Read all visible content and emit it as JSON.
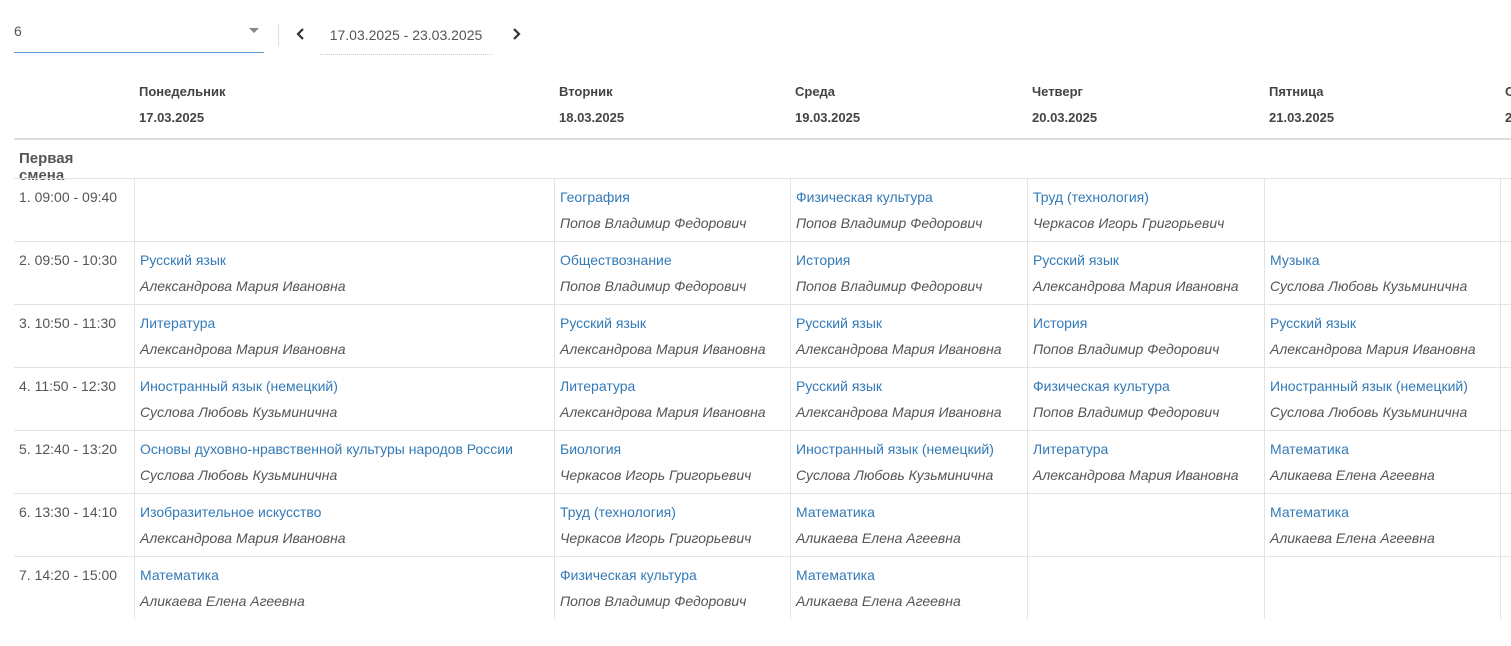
{
  "toolbar": {
    "class_value": "6",
    "week_range": "17.03.2025 - 23.03.2025"
  },
  "days": [
    {
      "name": "Понедельник",
      "date": "17.03.2025"
    },
    {
      "name": "Вторник",
      "date": "18.03.2025"
    },
    {
      "name": "Среда",
      "date": "19.03.2025"
    },
    {
      "name": "Четверг",
      "date": "20.03.2025"
    },
    {
      "name": "Пятница",
      "date": "21.03.2025"
    },
    {
      "name": "С",
      "date": "2"
    }
  ],
  "shift_title": "Первая смена",
  "periods": [
    {
      "time": "1. 09:00 - 09:40",
      "lessons": [
        null,
        {
          "subject": "География",
          "teacher": "Попов Владимир Федорович"
        },
        {
          "subject": "Физическая культура",
          "teacher": "Попов Владимир Федорович"
        },
        {
          "subject": "Труд (технология)",
          "teacher": "Черкасов Игорь Григорьевич"
        },
        null
      ]
    },
    {
      "time": "2. 09:50 - 10:30",
      "lessons": [
        {
          "subject": "Русский язык",
          "teacher": "Александрова Мария Ивановна"
        },
        {
          "subject": "Обществознание",
          "teacher": "Попов Владимир Федорович"
        },
        {
          "subject": "История",
          "teacher": "Попов Владимир Федорович"
        },
        {
          "subject": "Русский язык",
          "teacher": "Александрова Мария Ивановна"
        },
        {
          "subject": "Музыка",
          "teacher": "Суслова Любовь Кузьминична"
        }
      ]
    },
    {
      "time": "3. 10:50 - 11:30",
      "lessons": [
        {
          "subject": "Литература",
          "teacher": "Александрова Мария Ивановна"
        },
        {
          "subject": "Русский язык",
          "teacher": "Александрова Мария Ивановна"
        },
        {
          "subject": "Русский язык",
          "teacher": "Александрова Мария Ивановна"
        },
        {
          "subject": "История",
          "teacher": "Попов Владимир Федорович"
        },
        {
          "subject": "Русский язык",
          "teacher": "Александрова Мария Ивановна"
        }
      ]
    },
    {
      "time": "4. 11:50 - 12:30",
      "lessons": [
        {
          "subject": "Иностранный язык (немецкий)",
          "teacher": "Суслова Любовь Кузьминична"
        },
        {
          "subject": "Литература",
          "teacher": "Александрова Мария Ивановна"
        },
        {
          "subject": "Русский язык",
          "teacher": "Александрова Мария Ивановна"
        },
        {
          "subject": "Физическая культура",
          "teacher": "Попов Владимир Федорович"
        },
        {
          "subject": "Иностранный язык (немецкий)",
          "teacher": "Суслова Любовь Кузьминична"
        }
      ]
    },
    {
      "time": "5. 12:40 - 13:20",
      "lessons": [
        {
          "subject": "Основы духовно-нравственной культуры народов России",
          "teacher": "Суслова Любовь Кузьминична"
        },
        {
          "subject": "Биология",
          "teacher": "Черкасов Игорь Григорьевич"
        },
        {
          "subject": "Иностранный язык (немецкий)",
          "teacher": "Суслова Любовь Кузьминична"
        },
        {
          "subject": "Литература",
          "teacher": "Александрова Мария Ивановна"
        },
        {
          "subject": "Математика",
          "teacher": "Аликаева Елена Агеевна"
        }
      ]
    },
    {
      "time": "6. 13:30 - 14:10",
      "lessons": [
        {
          "subject": "Изобразительное искусство",
          "teacher": "Александрова Мария Ивановна"
        },
        {
          "subject": "Труд (технология)",
          "teacher": "Черкасов Игорь Григорьевич"
        },
        {
          "subject": "Математика",
          "teacher": "Аликаева Елена Агеевна"
        },
        null,
        {
          "subject": "Математика",
          "teacher": "Аликаева Елена Агеевна"
        }
      ]
    },
    {
      "time": "7. 14:20 - 15:00",
      "lessons": [
        {
          "subject": "Математика",
          "teacher": "Аликаева Елена Агеевна"
        },
        {
          "subject": "Физическая культура",
          "teacher": "Попов Владимир Федорович"
        },
        {
          "subject": "Математика",
          "teacher": "Аликаева Елена Агеевна"
        },
        null,
        null
      ]
    }
  ]
}
